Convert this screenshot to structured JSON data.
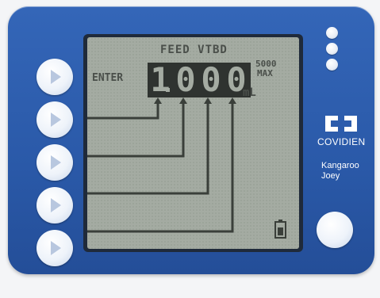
{
  "screen": {
    "header": "FEED VTBD",
    "max_value": "5000",
    "max_label": "MAX",
    "enter_label": "ENTER",
    "digits": [
      "1",
      "0",
      "0",
      "0"
    ],
    "unit": "mL"
  },
  "brand": {
    "company": "COVIDIEN",
    "product_line1": "Kangaroo",
    "product_line2": "Joey"
  },
  "icons": {
    "side_buttons": "play-triangle-icon",
    "battery": "battery-icon",
    "logo": "covidien-logo-icon"
  },
  "colors": {
    "device_body": "#2a59a8",
    "lcd_background": "#a4aba2",
    "lcd_foreground": "#3a3f3a"
  }
}
